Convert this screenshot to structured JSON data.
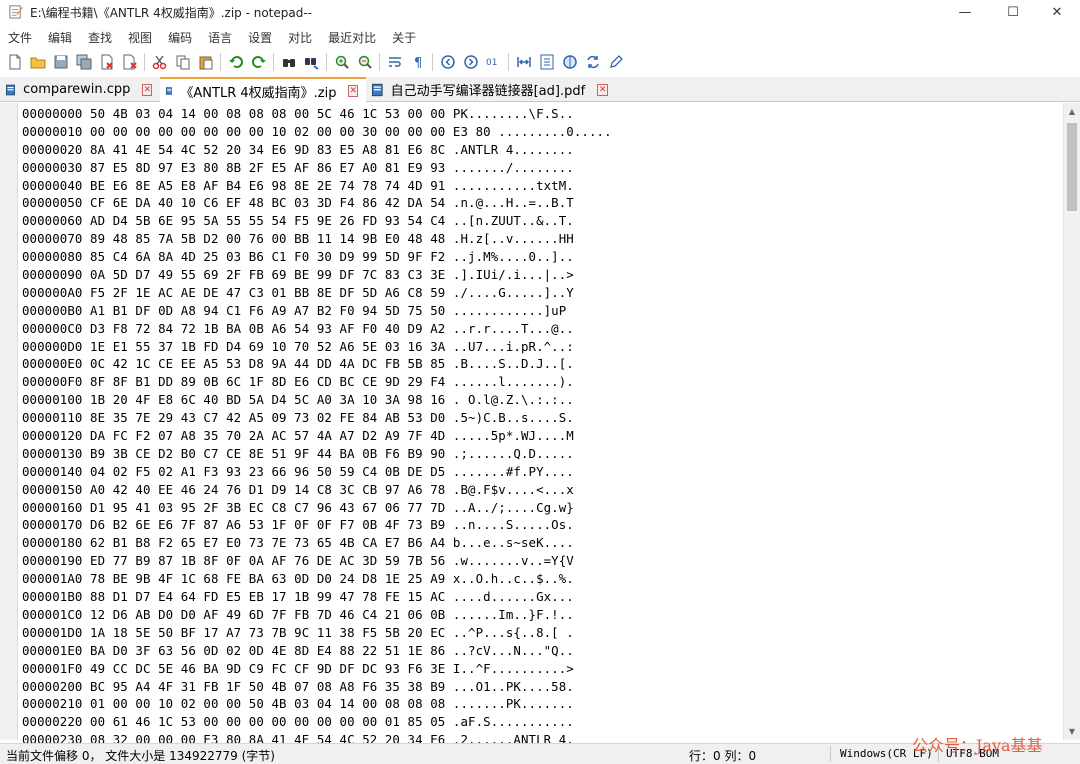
{
  "window": {
    "title": "E:\\编程书籍\\《ANTLR 4权威指南》.zip - notepad--",
    "minimize_glyph": "—",
    "maximize_glyph": "☐",
    "close_glyph": "✕"
  },
  "menu": [
    "文件",
    "编辑",
    "查找",
    "视图",
    "编码",
    "语言",
    "设置",
    "对比",
    "最近对比",
    "关于"
  ],
  "toolbar": [
    "new-file-icon",
    "open-folder-icon",
    "save-icon",
    "save-all-icon",
    "close-icon",
    "close-all-icon",
    "cut-icon",
    "copy-icon",
    "paste-icon",
    "undo-icon",
    "redo-icon",
    "find-icon",
    "replace-icon",
    "zoom-in-icon",
    "zoom-out-icon",
    "word-wrap-icon",
    "show-symbols-icon",
    "prev-icon",
    "next-icon",
    "binary-icon",
    "compare-icon",
    "file-list-icon",
    "sync-icon",
    "refresh-icon",
    "edit-icon"
  ],
  "tabs": [
    {
      "label": "comparewin.cpp",
      "active": false
    },
    {
      "label": "《ANTLR 4权威指南》.zip",
      "active": true
    },
    {
      "label": "自己动手写编译器链接器[ad].pdf",
      "active": false
    }
  ],
  "tab_close_glyph": "✕",
  "hex_lines": [
    "00000000 50 4B 03 04 14 00 08 08 08 00 5C 46 1C 53 00 00 PK........\\F.S..",
    "00000010 00 00 00 00 00 00 00 00 10 02 00 00 30 00 00 00 E3 80 .........0.....",
    "00000020 8A 41 4E 54 4C 52 20 34 E6 9D 83 E5 A8 81 E6 8C .ANTLR 4........",
    "00000030 87 E5 8D 97 E3 80 8B 2F E5 AF 86 E7 A0 81 E9 93 ......./........",
    "00000040 BE E6 8E A5 E8 AF B4 E6 98 8E 2E 74 78 74 4D 91 ...........txtM.",
    "00000050 CF 6E DA 40 10 C6 EF 48 BC 03 3D F4 86 42 DA 54 .n.@...H..=..B.T",
    "00000060 AD D4 5B 6E 95 5A 55 55 54 F5 9E 26 FD 93 54 C4 ..[n.ZUUT..&..T.",
    "00000070 89 48 85 7A 5B D2 00 76 00 BB 11 14 9B E0 48 48 .H.z[..v......HH",
    "00000080 85 C4 6A 8A 4D 25 03 B6 C1 F0 30 D9 99 5D 9F F2 ..j.M%....0..]..",
    "00000090 0A 5D D7 49 55 69 2F FB 69 BE 99 DF 7C 83 C3 3E .].IUi/.i...|..>",
    "000000A0 F5 2F 1E AC AE DE 47 C3 01 BB 8E DF 5D A6 C8 59 ./....G.....]..Y",
    "000000B0 A1 B1 DF 0D A8 94 C1 F6 A9 A7 B2 F0 94 5D 75 50 ............]uP",
    "000000C0 D3 F8 72 84 72 1B BA 0B A6 54 93 AF F0 40 D9 A2 ..r.r....T...@..",
    "000000D0 1E E1 55 37 1B FD D4 69 10 70 52 A6 5E 03 16 3A ..U7...i.pR.^..:",
    "000000E0 0C 42 1C CE EE A5 53 D8 9A 44 DD 4A DC FB 5B 85 .B....S..D.J..[.",
    "000000F0 8F 8F B1 DD 89 0B 6C 1F 8D E6 CD BC CE 9D 29 F4 ......l.......).",
    "00000100 1B 20 4F E8 6C 40 BD 5A D4 5C A0 3A 10 3A 98 16 . O.l@.Z.\\.:.:..",
    "00000110 8E 35 7E 29 43 C7 42 A5 09 73 02 FE 84 AB 53 D0 .5~)C.B..s....S.",
    "00000120 DA FC F2 07 A8 35 70 2A AC 57 4A A7 D2 A9 7F 4D .....5p*.WJ....M",
    "00000130 B9 3B CE D2 B0 C7 CE 8E 51 9F 44 BA 0B F6 B9 90 .;......Q.D.....",
    "00000140 04 02 F5 02 A1 F3 93 23 66 96 50 59 C4 0B DE D5 .......#f.PY....",
    "00000150 A0 42 40 EE 46 24 76 D1 D9 14 C8 3C CB 97 A6 78 .B@.F$v....<...x",
    "00000160 D1 95 41 03 95 2F 3B EC C8 C7 96 43 67 06 77 7D ..A../;....Cg.w}",
    "00000170 D6 B2 6E E6 7F 87 A6 53 1F 0F 0F F7 0B 4F 73 B9 ..n....S.....Os.",
    "00000180 62 B1 B8 F2 65 E7 E0 73 7E 73 65 4B CA E7 B6 A4 b...e..s~seK....",
    "00000190 ED 77 B9 87 1B 8F 0F 0A AF 76 DE AC 3D 59 7B 56 .w.......v..=Y{V",
    "000001A0 78 BE 9B 4F 1C 68 FE BA 63 0D D0 24 D8 1E 25 A9 x..O.h..c..$..%.",
    "000001B0 88 D1 D7 E4 64 FD E5 EB 17 1B 99 47 78 FE 15 AC ....d......Gx...",
    "000001C0 12 D6 AB D0 D0 AF 49 6D 7F FB 7D 46 C4 21 06 0B ......Im..}F.!..",
    "000001D0 1A 18 5E 50 BF 17 A7 73 7B 9C 11 38 F5 5B 20 EC ..^P...s{..8.[ .",
    "000001E0 BA D0 3F 63 56 0D 02 0D 4E 8D E4 88 22 51 1E 86 ..?cV...N...\"Q..",
    "000001F0 49 CC DC 5E 46 BA 9D C9 FC CF 9D DF DC 93 F6 3E I..^F..........>",
    "00000200 BC 95 A4 4F 31 FB 1F 50 4B 07 08 A8 F6 35 38 B9 ...O1..PK....58.",
    "00000210 01 00 00 10 02 00 00 50 4B 03 04 14 00 08 08 08 .......PK.......",
    "00000220 00 61 46 1C 53 00 00 00 00 00 00 00 00 01 85 05 .aF.S...........",
    "00000230 08 32 00 00 00 E3 80 8A 41 4E 54 4C 52 20 34 E6 .2......ANTLR 4."
  ],
  "status": {
    "offset_info": "当前文件偏移 0，  文件大小是 134922779  (字节)",
    "cursor": "行：0  列：0",
    "eol": "Windows(CR LF)",
    "encoding": "UTF8-BOM"
  },
  "watermark": "公众号：Java基基"
}
